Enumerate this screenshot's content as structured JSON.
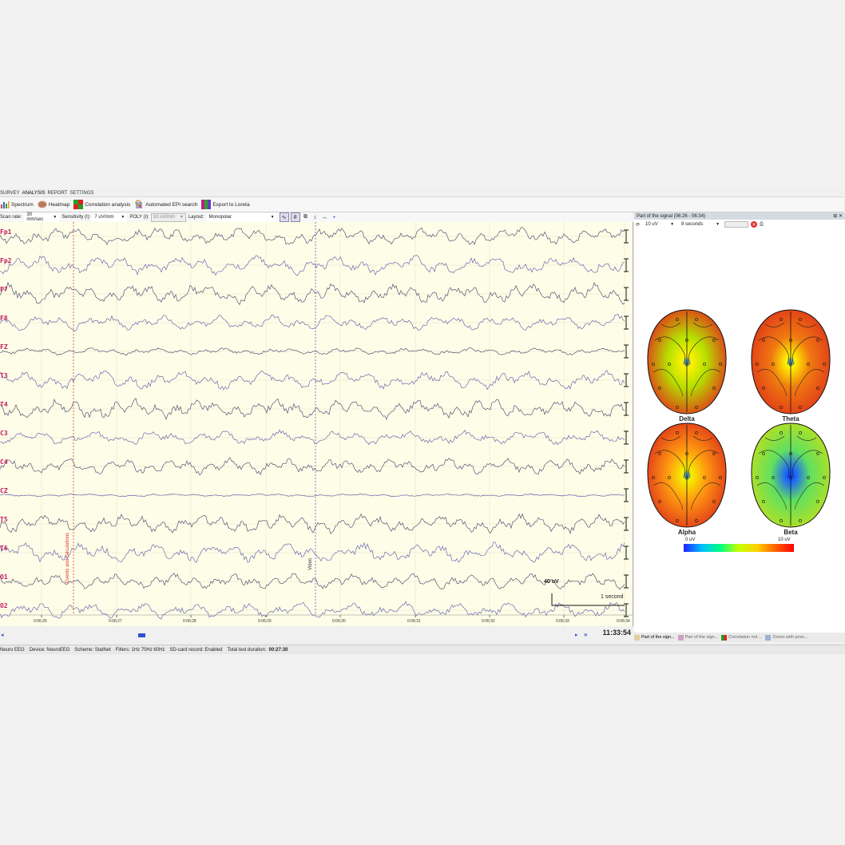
{
  "tabs": [
    "SURVEY",
    "ANALYSIS",
    "REPORT",
    "SETTINGS"
  ],
  "ribbon": [
    {
      "label": "Spectrum",
      "icon": "spectrum-icon"
    },
    {
      "label": "Heatmap",
      "icon": "heatmap-brain-icon"
    },
    {
      "label": "Correlation analysis",
      "icon": "correlation-icon"
    },
    {
      "label": "Automated EPI search",
      "icon": "epi-search-icon"
    },
    {
      "label": "Export to Loreta",
      "icon": "loreta-icon"
    }
  ],
  "settings": {
    "scan_rate_label": "Scan rate:",
    "scan_rate": "30 mm/sec",
    "sensitivity_label": "Sensitivity (I):",
    "sensitivity": "7 uV/mm",
    "poly_label": "POLY (I):",
    "poly": "10 uV/mm",
    "layout_label": "Layout:",
    "layout": "Monopolar"
  },
  "channels": [
    "Fp1",
    "Fp2",
    "F7",
    "F8",
    "FZ",
    "T3",
    "T4",
    "C3",
    "C4",
    "CZ",
    "T5",
    "T6",
    "O1",
    "O2"
  ],
  "markers": {
    "event1": "Events and calculations",
    "event2": "Video"
  },
  "time_ticks": [
    "0:06:26",
    "0:06:27",
    "0:06:28",
    "0:06:29",
    "0:06:30",
    "0:06:31",
    "0:06:32",
    "0:06:33",
    "0:06:34"
  ],
  "scale": {
    "amplitude": "40 uV",
    "time": "1 second"
  },
  "clock": "11:33:54",
  "status": {
    "app": "Neuro EEG",
    "device": "Device:  NeuroEEG",
    "scheme": "Scheme:  StatNet",
    "filters": "Filters:  1Hz 70Hz 60Hz",
    "sd": "SD-card record:  Enabled",
    "total_label": "Total test duration:",
    "total": "00:27:30"
  },
  "right_panel": {
    "title": "Part of the signal (06:26 - 06:34)",
    "amp": "10 uV",
    "window": "8 seconds",
    "maps": [
      {
        "label": "Delta"
      },
      {
        "label": "Theta"
      },
      {
        "label": "Alpha"
      },
      {
        "label": "Beta"
      }
    ],
    "colorbar_min": "0 uV",
    "colorbar_max": "10 uV"
  },
  "bottom_tabs": [
    "Part of the sign...",
    "Part of the sign...",
    "Correlation not ...",
    "Zones with poss..."
  ]
}
